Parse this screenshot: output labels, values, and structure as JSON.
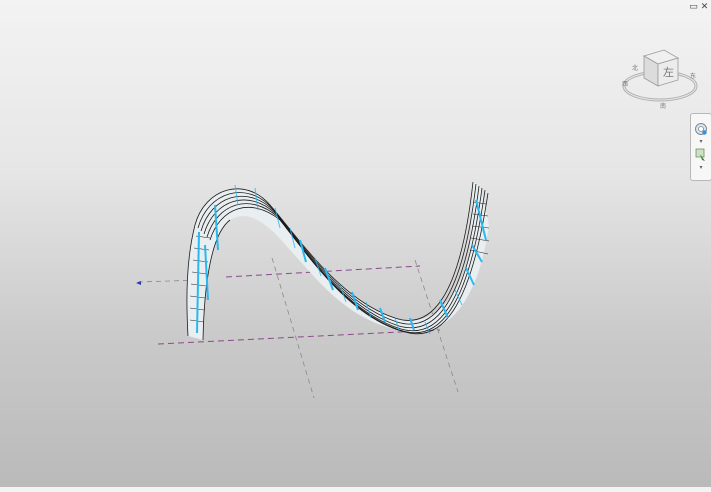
{
  "window_controls": {
    "restore_glyph": "▭",
    "close_glyph": "✕"
  },
  "viewcube": {
    "face_label": "左",
    "compass_labels": [
      "东",
      "南",
      "西",
      "北"
    ]
  },
  "navigation_bar": {
    "items": [
      {
        "name": "steering-wheel-icon"
      },
      {
        "name": "zoom-icon"
      }
    ]
  },
  "colors": {
    "model_edges": "#1a1a1a",
    "model_highlight": "#29b8f0",
    "reference_plane": "#8a4b8a",
    "background_top": "#f3f3f3",
    "background_bottom": "#bababa"
  }
}
